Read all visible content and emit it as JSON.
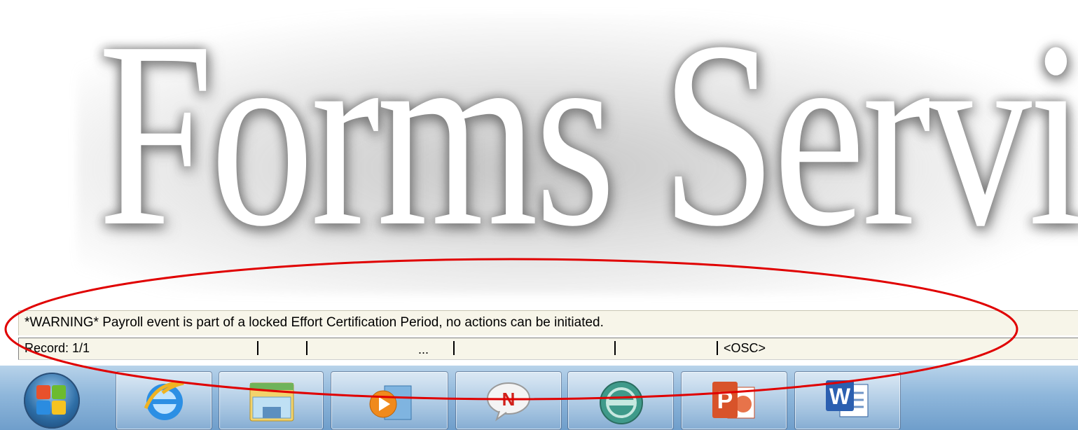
{
  "watermark": {
    "text": "Forms Service"
  },
  "status": {
    "warning": "*WARNING* Payroll event is part of a locked Effort Certification Period, no actions can be initiated.",
    "record": "Record: 1/1",
    "ellipsis": "...",
    "osc": "<OSC>"
  },
  "taskbar": {
    "items": [
      {
        "name": "start-button",
        "icon": "windows-orb-icon"
      },
      {
        "name": "internet-explorer",
        "icon": "internet-explorer-icon",
        "label": "e"
      },
      {
        "name": "file-explorer",
        "icon": "folder-icon"
      },
      {
        "name": "media-player",
        "icon": "media-player-icon"
      },
      {
        "name": "notes-app",
        "icon": "notes-n-icon",
        "label": "N"
      },
      {
        "name": "globe-app",
        "icon": "globe-icon"
      },
      {
        "name": "powerpoint",
        "icon": "powerpoint-icon",
        "label": "P"
      },
      {
        "name": "word",
        "icon": "word-icon",
        "label": "W"
      }
    ]
  },
  "colors": {
    "annotation": "#e00000",
    "status_bg": "#f7f5e9",
    "taskbar": "#8fb7db"
  }
}
